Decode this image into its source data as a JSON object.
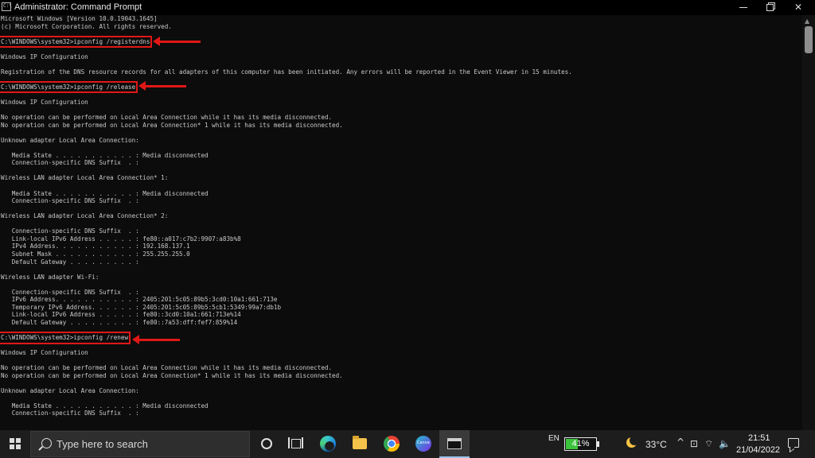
{
  "window": {
    "icon_text": "C:\\",
    "title": "Administrator: Command Prompt",
    "controls": {
      "minimize": "",
      "maximize": "",
      "close": "✕"
    }
  },
  "console": {
    "lines": [
      "Microsoft Windows [Version 10.0.19043.1645]",
      "(c) Microsoft Corporation. All rights reserved.",
      "",
      "C:\\WINDOWS\\system32>ipconfig /registerdns",
      "",
      "Windows IP Configuration",
      "",
      "Registration of the DNS resource records for all adapters of this computer has been initiated. Any errors will be reported in the Event Viewer in 15 minutes.",
      "",
      "C:\\WINDOWS\\system32>ipconfig /release",
      "",
      "Windows IP Configuration",
      "",
      "No operation can be performed on Local Area Connection while it has its media disconnected.",
      "No operation can be performed on Local Area Connection* 1 while it has its media disconnected.",
      "",
      "Unknown adapter Local Area Connection:",
      "",
      "   Media State . . . . . . . . . . . : Media disconnected",
      "   Connection-specific DNS Suffix  . :",
      "",
      "Wireless LAN adapter Local Area Connection* 1:",
      "",
      "   Media State . . . . . . . . . . . : Media disconnected",
      "   Connection-specific DNS Suffix  . :",
      "",
      "Wireless LAN adapter Local Area Connection* 2:",
      "",
      "   Connection-specific DNS Suffix  . :",
      "   Link-local IPv6 Address . . . . . : fe80::a017:c7b2:9907:a83b%8",
      "   IPv4 Address. . . . . . . . . . . : 192.168.137.1",
      "   Subnet Mask . . . . . . . . . . . : 255.255.255.0",
      "   Default Gateway . . . . . . . . . :",
      "",
      "Wireless LAN adapter Wi-Fi:",
      "",
      "   Connection-specific DNS Suffix  . :",
      "   IPv6 Address. . . . . . . . . . . : 2405:201:5c05:89b5:3cd0:10a1:661:713e",
      "   Temporary IPv6 Address. . . . . . : 2405:201:5c05:89b5:5cb1:5349:99a7:db1b",
      "   Link-local IPv6 Address . . . . . : fe80::3cd0:10a1:661:713e%14",
      "   Default Gateway . . . . . . . . . : fe80::7a53:dff:fef7:859%14",
      "",
      "C:\\WINDOWS\\system32>ipconfig /renew",
      "",
      "Windows IP Configuration",
      "",
      "No operation can be performed on Local Area Connection while it has its media disconnected.",
      "No operation can be performed on Local Area Connection* 1 while it has its media disconnected.",
      "",
      "Unknown adapter Local Area Connection:",
      "",
      "   Media State . . . . . . . . . . . : Media disconnected",
      "   Connection-specific DNS Suffix  . :"
    ]
  },
  "scrollbar": {
    "up_glyph": "▲"
  },
  "taskbar": {
    "search_placeholder": "Type here to search",
    "language": "EN",
    "battery_percent": "41%",
    "battery_level": 0.41,
    "temperature": "33°C",
    "time": "21:51",
    "date": "21/04/2022",
    "tray_glyphs": {
      "chevron": "^",
      "network": "⊡",
      "wifi": "⌔",
      "volume": "🔈"
    }
  },
  "colors": {
    "highlight": "#e11717",
    "console_bg": "#0c0c0c",
    "console_text": "#c9c9c9",
    "taskbar_bg": "#1d1d1d",
    "battery_fill": "#3cc43c"
  }
}
